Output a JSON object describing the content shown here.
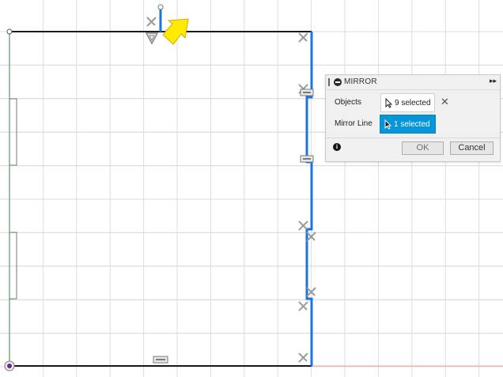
{
  "mirror_dialog": {
    "title": "MIRROR",
    "objects_label": "Objects",
    "objects_value": "9 selected",
    "mirror_line_label": "Mirror Line",
    "mirror_line_value": "1 selected",
    "ok_label": "OK",
    "cancel_label": "Cancel",
    "info_glyph": "i",
    "clear_glyph": "✕",
    "expand_glyph": "▸▸"
  },
  "icons": [
    "collapse-handle-icon",
    "minus-circle-icon",
    "expand-arrows-icon",
    "cursor-arrow-icon",
    "clear-x-icon",
    "info-icon",
    "highlight-arrow-icon",
    "perpendicular-constraint-icon",
    "horizontal-constraint-icon",
    "tangent-constraint-icon",
    "origin-icon"
  ],
  "colors": {
    "background": "#ffffff",
    "grid": "#dcdcdc",
    "sketch_line": "#1a1a1a",
    "selected_line": "#1a75e0",
    "constraint_icon": "#9a9a9a",
    "highlight_arrow": "#ffeb00",
    "axis_green": "#3a8a3a",
    "axis_red": "#f2a0a0",
    "active_button": "#0696d7"
  }
}
